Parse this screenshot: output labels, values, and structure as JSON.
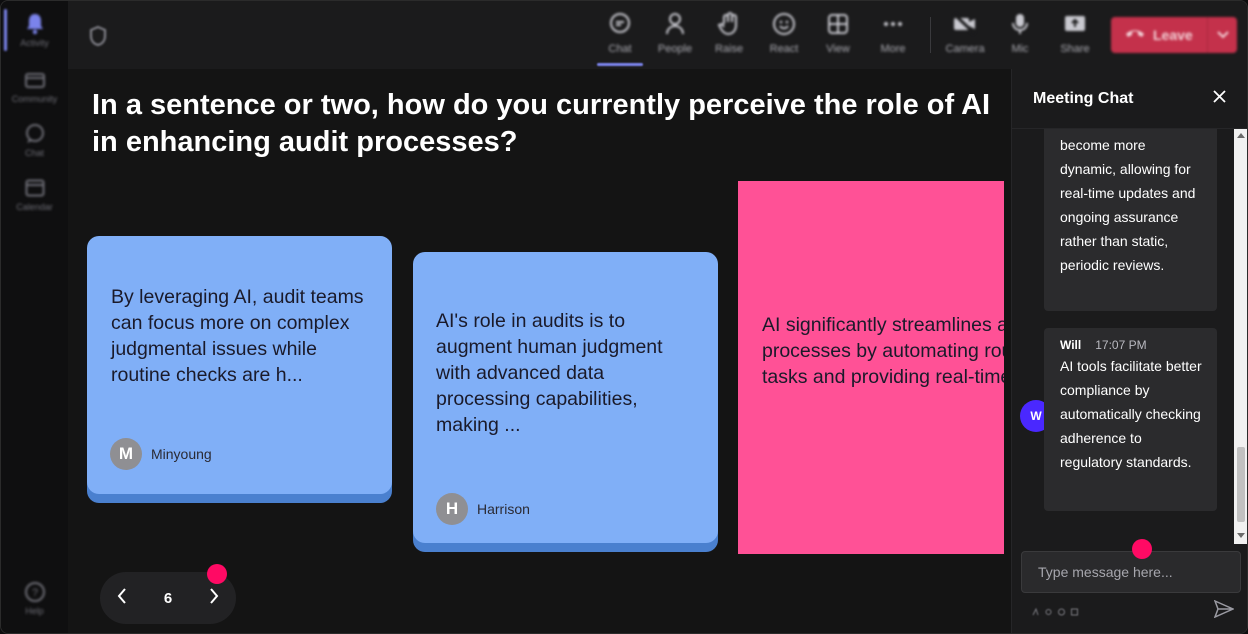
{
  "rail": {
    "items": [
      {
        "label": "Activity",
        "icon": "bell-icon"
      },
      {
        "label": "Community",
        "icon": "community-icon"
      },
      {
        "label": "Chat",
        "icon": "chat-icon"
      },
      {
        "label": "Calendar",
        "icon": "calendar-icon"
      }
    ],
    "help_label": "Help"
  },
  "toolbar": {
    "chat": "Chat",
    "people": "People",
    "raise": "Raise",
    "react": "React",
    "view": "View",
    "more": "More",
    "camera": "Camera",
    "mic": "Mic",
    "share": "Share",
    "leave": "Leave"
  },
  "question": "In a sentence or two, how do you currently perceive the role of AI in enhancing audit processes?",
  "cards": [
    {
      "text": "By leveraging AI, audit teams can focus more on complex judgmental issues while routine checks are h...",
      "author": "Minyoung",
      "initial": "M",
      "color": "#80aff7"
    },
    {
      "text": "AI's role in audits is to augment human judgment with advanced data processing capabilities, making ...",
      "author": "Harrison",
      "initial": "H",
      "color": "#80aff7"
    },
    {
      "text": "AI significantly streamlines audit processes by automating routine tasks and providing real-time dat...",
      "color": "#ff5196"
    }
  ],
  "pager": {
    "page": "6"
  },
  "chat": {
    "title": "Meeting Chat",
    "messages": [
      {
        "text": "become more dynamic, allowing for real-time updates and ongoing assurance rather than static, periodic reviews."
      },
      {
        "name": "Will",
        "time": "17:07 PM",
        "initial": "W",
        "text": "AI tools facilitate better compliance by automatically checking adherence to regulatory standards."
      }
    ],
    "input_placeholder": "Type message here..."
  },
  "colors": {
    "accent": "#7b83eb",
    "leave": "#c4314b",
    "card_blue": "#80aff7",
    "card_pink": "#ff5196",
    "marker": "#ff0a64"
  }
}
